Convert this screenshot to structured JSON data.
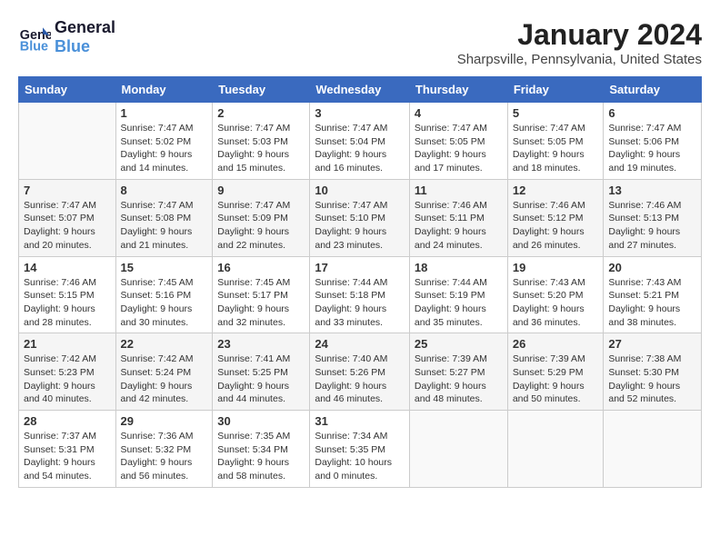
{
  "header": {
    "logo_line1": "General",
    "logo_line2": "Blue",
    "title": "January 2024",
    "subtitle": "Sharpsville, Pennsylvania, United States"
  },
  "days_of_week": [
    "Sunday",
    "Monday",
    "Tuesday",
    "Wednesday",
    "Thursday",
    "Friday",
    "Saturday"
  ],
  "weeks": [
    [
      {
        "num": "",
        "info": ""
      },
      {
        "num": "1",
        "info": "Sunrise: 7:47 AM\nSunset: 5:02 PM\nDaylight: 9 hours\nand 14 minutes."
      },
      {
        "num": "2",
        "info": "Sunrise: 7:47 AM\nSunset: 5:03 PM\nDaylight: 9 hours\nand 15 minutes."
      },
      {
        "num": "3",
        "info": "Sunrise: 7:47 AM\nSunset: 5:04 PM\nDaylight: 9 hours\nand 16 minutes."
      },
      {
        "num": "4",
        "info": "Sunrise: 7:47 AM\nSunset: 5:05 PM\nDaylight: 9 hours\nand 17 minutes."
      },
      {
        "num": "5",
        "info": "Sunrise: 7:47 AM\nSunset: 5:05 PM\nDaylight: 9 hours\nand 18 minutes."
      },
      {
        "num": "6",
        "info": "Sunrise: 7:47 AM\nSunset: 5:06 PM\nDaylight: 9 hours\nand 19 minutes."
      }
    ],
    [
      {
        "num": "7",
        "info": "Sunrise: 7:47 AM\nSunset: 5:07 PM\nDaylight: 9 hours\nand 20 minutes."
      },
      {
        "num": "8",
        "info": "Sunrise: 7:47 AM\nSunset: 5:08 PM\nDaylight: 9 hours\nand 21 minutes."
      },
      {
        "num": "9",
        "info": "Sunrise: 7:47 AM\nSunset: 5:09 PM\nDaylight: 9 hours\nand 22 minutes."
      },
      {
        "num": "10",
        "info": "Sunrise: 7:47 AM\nSunset: 5:10 PM\nDaylight: 9 hours\nand 23 minutes."
      },
      {
        "num": "11",
        "info": "Sunrise: 7:46 AM\nSunset: 5:11 PM\nDaylight: 9 hours\nand 24 minutes."
      },
      {
        "num": "12",
        "info": "Sunrise: 7:46 AM\nSunset: 5:12 PM\nDaylight: 9 hours\nand 26 minutes."
      },
      {
        "num": "13",
        "info": "Sunrise: 7:46 AM\nSunset: 5:13 PM\nDaylight: 9 hours\nand 27 minutes."
      }
    ],
    [
      {
        "num": "14",
        "info": "Sunrise: 7:46 AM\nSunset: 5:15 PM\nDaylight: 9 hours\nand 28 minutes."
      },
      {
        "num": "15",
        "info": "Sunrise: 7:45 AM\nSunset: 5:16 PM\nDaylight: 9 hours\nand 30 minutes."
      },
      {
        "num": "16",
        "info": "Sunrise: 7:45 AM\nSunset: 5:17 PM\nDaylight: 9 hours\nand 32 minutes."
      },
      {
        "num": "17",
        "info": "Sunrise: 7:44 AM\nSunset: 5:18 PM\nDaylight: 9 hours\nand 33 minutes."
      },
      {
        "num": "18",
        "info": "Sunrise: 7:44 AM\nSunset: 5:19 PM\nDaylight: 9 hours\nand 35 minutes."
      },
      {
        "num": "19",
        "info": "Sunrise: 7:43 AM\nSunset: 5:20 PM\nDaylight: 9 hours\nand 36 minutes."
      },
      {
        "num": "20",
        "info": "Sunrise: 7:43 AM\nSunset: 5:21 PM\nDaylight: 9 hours\nand 38 minutes."
      }
    ],
    [
      {
        "num": "21",
        "info": "Sunrise: 7:42 AM\nSunset: 5:23 PM\nDaylight: 9 hours\nand 40 minutes."
      },
      {
        "num": "22",
        "info": "Sunrise: 7:42 AM\nSunset: 5:24 PM\nDaylight: 9 hours\nand 42 minutes."
      },
      {
        "num": "23",
        "info": "Sunrise: 7:41 AM\nSunset: 5:25 PM\nDaylight: 9 hours\nand 44 minutes."
      },
      {
        "num": "24",
        "info": "Sunrise: 7:40 AM\nSunset: 5:26 PM\nDaylight: 9 hours\nand 46 minutes."
      },
      {
        "num": "25",
        "info": "Sunrise: 7:39 AM\nSunset: 5:27 PM\nDaylight: 9 hours\nand 48 minutes."
      },
      {
        "num": "26",
        "info": "Sunrise: 7:39 AM\nSunset: 5:29 PM\nDaylight: 9 hours\nand 50 minutes."
      },
      {
        "num": "27",
        "info": "Sunrise: 7:38 AM\nSunset: 5:30 PM\nDaylight: 9 hours\nand 52 minutes."
      }
    ],
    [
      {
        "num": "28",
        "info": "Sunrise: 7:37 AM\nSunset: 5:31 PM\nDaylight: 9 hours\nand 54 minutes."
      },
      {
        "num": "29",
        "info": "Sunrise: 7:36 AM\nSunset: 5:32 PM\nDaylight: 9 hours\nand 56 minutes."
      },
      {
        "num": "30",
        "info": "Sunrise: 7:35 AM\nSunset: 5:34 PM\nDaylight: 9 hours\nand 58 minutes."
      },
      {
        "num": "31",
        "info": "Sunrise: 7:34 AM\nSunset: 5:35 PM\nDaylight: 10 hours\nand 0 minutes."
      },
      {
        "num": "",
        "info": ""
      },
      {
        "num": "",
        "info": ""
      },
      {
        "num": "",
        "info": ""
      }
    ]
  ]
}
